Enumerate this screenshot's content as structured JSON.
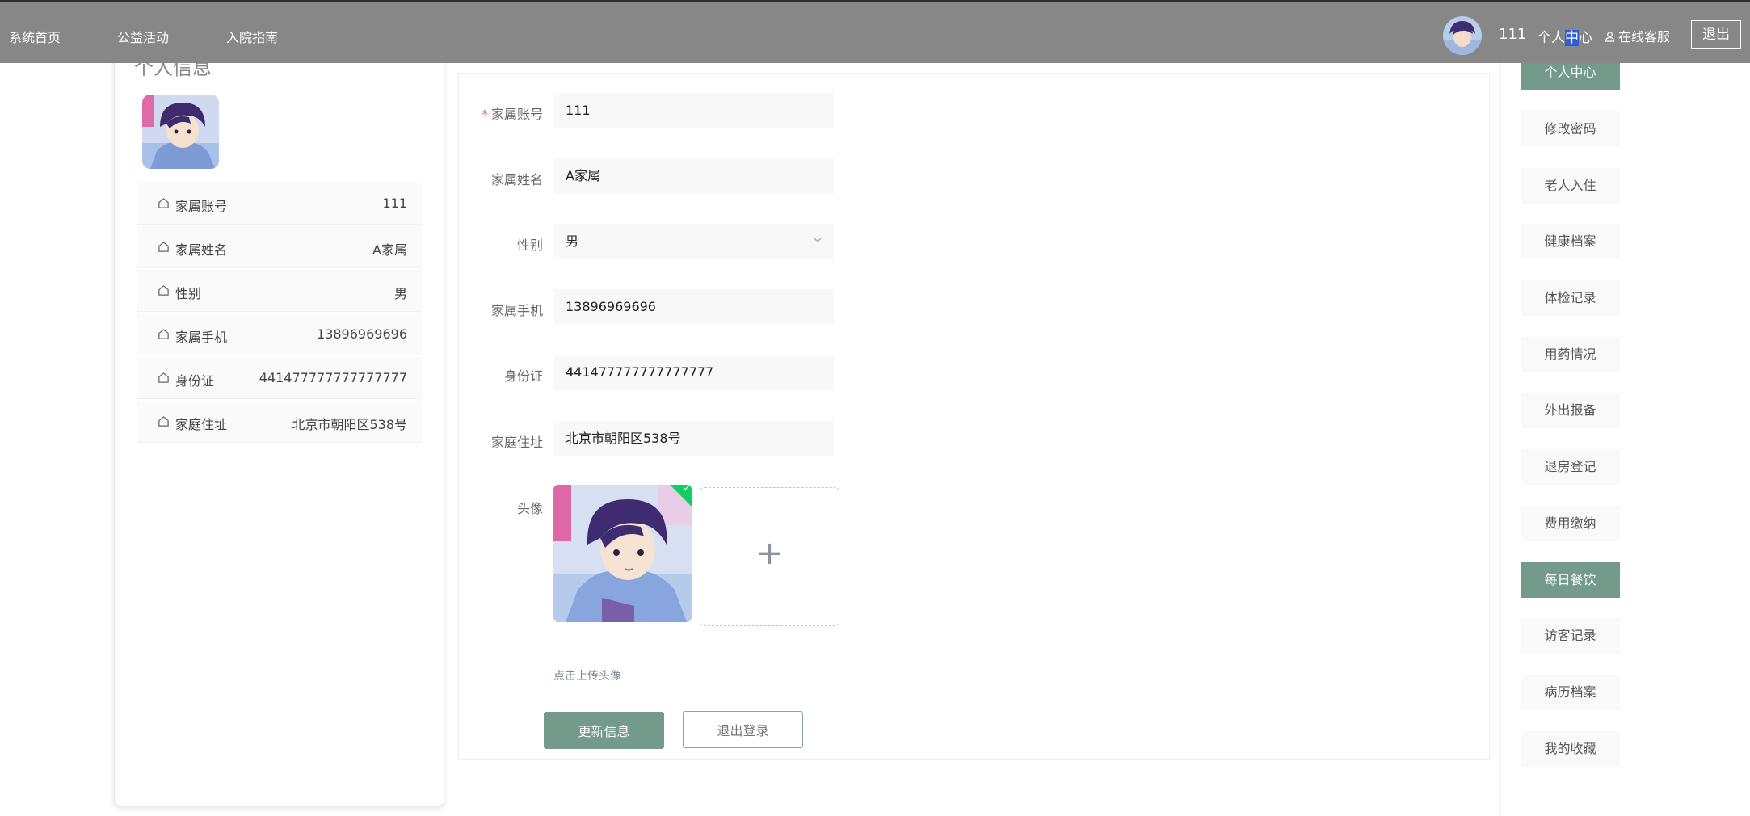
{
  "nav": {
    "items": [
      "系统首页",
      "公益活动",
      "入院指南"
    ],
    "user": "111",
    "center_pre": "个人",
    "center_sel": "中",
    "center_post": "心",
    "service": "在线客服",
    "logout": "退出"
  },
  "left": {
    "title": "个人信息",
    "rows": [
      {
        "label": "家属账号",
        "value": "111"
      },
      {
        "label": "家属姓名",
        "value": "A家属"
      },
      {
        "label": "性别",
        "value": "男"
      },
      {
        "label": "家属手机",
        "value": "13896969696"
      },
      {
        "label": "身份证",
        "value": "441477777777777777"
      },
      {
        "label": "家庭住址",
        "value": "北京市朝阳区538号"
      }
    ]
  },
  "form": {
    "required_mark": "*",
    "fields": [
      {
        "label": "家属账号",
        "value": "111"
      },
      {
        "label": "家属姓名",
        "value": "A家属"
      },
      {
        "label": "性别",
        "value": "男"
      },
      {
        "label": "家属手机",
        "value": "13896969696"
      },
      {
        "label": "身份证",
        "value": "441477777777777777"
      },
      {
        "label": "家庭住址",
        "value": "北京市朝阳区538号"
      }
    ],
    "avatar_label": "头像",
    "upload_tip": "点击上传头像",
    "plus": "+",
    "check": "✓",
    "update_button": "更新信息",
    "logout_button": "退出登录"
  },
  "menu": {
    "items": [
      {
        "label": "个人中心",
        "active": true
      },
      {
        "label": "修改密码",
        "active": false
      },
      {
        "label": "老人入住",
        "active": false
      },
      {
        "label": "健康档案",
        "active": false
      },
      {
        "label": "体检记录",
        "active": false
      },
      {
        "label": "用药情况",
        "active": false
      },
      {
        "label": "外出报备",
        "active": false
      },
      {
        "label": "退房登记",
        "active": false
      },
      {
        "label": "费用缴纳",
        "active": false
      },
      {
        "label": "每日餐饮",
        "active": true
      },
      {
        "label": "访客记录",
        "active": false
      },
      {
        "label": "病历档案",
        "active": false
      },
      {
        "label": "我的收藏",
        "active": false
      }
    ]
  },
  "colors": {
    "accent": "#749a8c",
    "nav_bg": "#878787",
    "selection": "#2f5bd8",
    "required": "#f56c6c"
  }
}
